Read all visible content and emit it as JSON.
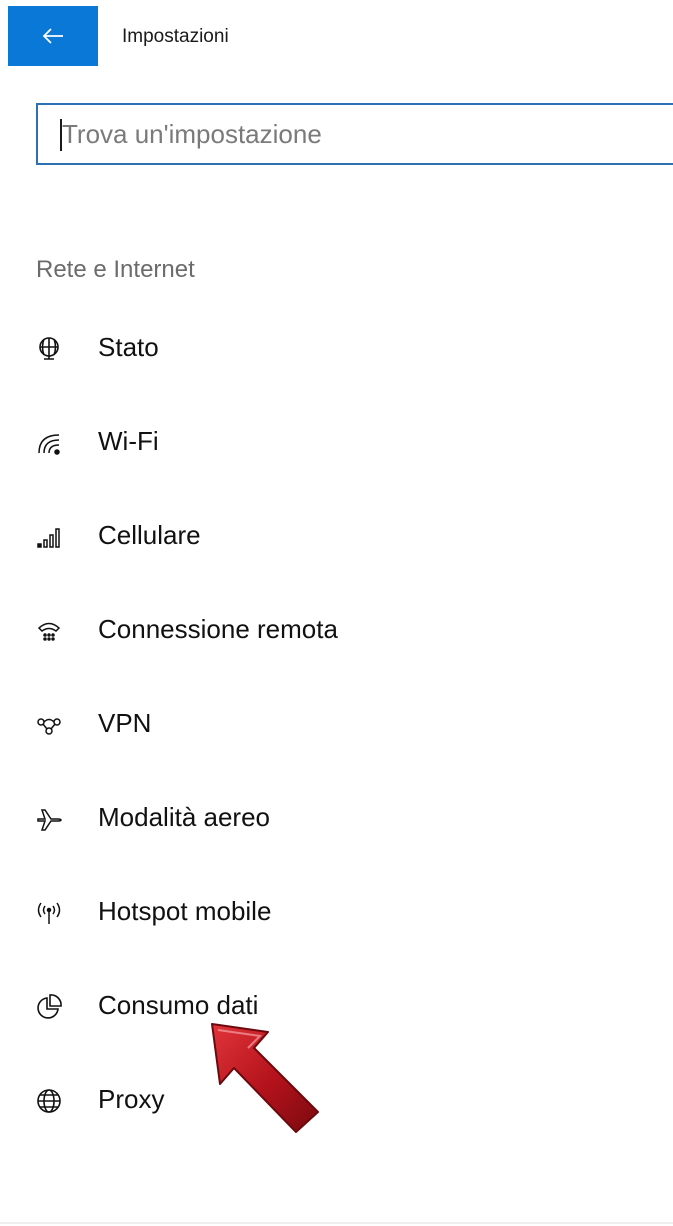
{
  "window": {
    "title": "Impostazioni",
    "back_icon": "arrow-left-icon",
    "accent": "#0a78d7"
  },
  "search": {
    "placeholder": "Trova un'impostazione",
    "value": ""
  },
  "section": {
    "title": "Rete e Internet"
  },
  "nav": {
    "items": [
      {
        "label": "Stato",
        "icon": "network-status-icon"
      },
      {
        "label": "Wi-Fi",
        "icon": "wifi-icon"
      },
      {
        "label": "Cellulare",
        "icon": "cellular-signal-icon"
      },
      {
        "label": "Connessione remota",
        "icon": "dial-up-phone-icon"
      },
      {
        "label": "VPN",
        "icon": "vpn-icon"
      },
      {
        "label": "Modalità aereo",
        "icon": "airplane-icon"
      },
      {
        "label": "Hotspot mobile",
        "icon": "hotspot-icon"
      },
      {
        "label": "Consumo dati",
        "icon": "data-usage-pie-icon"
      },
      {
        "label": "Proxy",
        "icon": "globe-icon"
      }
    ]
  },
  "annotation": {
    "arrow_color": "#b3121b",
    "arrow_icon": "red-pointer-arrow-icon"
  }
}
